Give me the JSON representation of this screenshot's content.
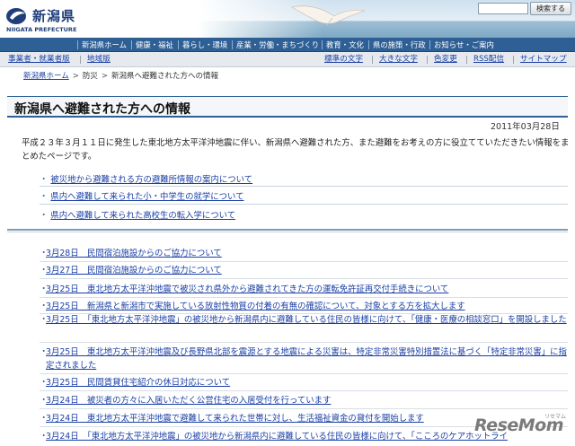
{
  "header": {
    "logo_text": "新潟県",
    "logo_sub": "NIIGATA PREFECTURE",
    "search_button": "検索する"
  },
  "nav": {
    "items": [
      "新潟県ホーム",
      "健康・福祉",
      "暮らし・環境",
      "産業・労働・まちづくり",
      "教育・文化",
      "県の施策・行政",
      "お知らせ・ご案内"
    ]
  },
  "util": {
    "left": [
      "事業者・就業者版",
      "地域版"
    ],
    "right": [
      "標準の文字",
      "大きな文字",
      "色変更",
      "RSS配信",
      "サイトマップ"
    ]
  },
  "breadcrumb": {
    "home": "新潟県ホーム",
    "section": "防災",
    "current": "新潟県へ避難された方への情報",
    "sep": ">"
  },
  "page": {
    "title": "新潟県へ避難された方への情報",
    "date": "2011年03月28日",
    "intro": "平成２３年３月１１日に発生した東北地方太平洋沖地震に伴い、新潟県へ避難された方、また避難をお考えの方に役立てていただきたい情報をまとめたページです。",
    "bullet": "・",
    "links": [
      "被災地から避難される方の避難所情報の案内について",
      "県内へ避難して来られた小・中学生の就学について",
      "県内へ避難して来られた高校生の転入学について"
    ],
    "news": [
      "3月28日　民間宿泊施設からのご協力について",
      "3月27日　民間宿泊施設からのご協力について",
      "3月25日　東北地方太平洋沖地震で被災され県外から避難されてきた方の運転免許証再交付手続きについて",
      "3月25日　新潟県と新潟市で実施している放射性物質の付着の有無の確認について、対象とする方を拡大します",
      "3月25日　「東北地方太平洋沖地震」の被災地から新潟県内に避難している住民の皆様に向けて、「健康・医療の相談窓口」を開設しました",
      "3月25日　東北地方太平洋沖地震及び長野県北部を震源とする地震による災害は、特定非常災害特別措置法に基づく「特定非常災害」に指定されました",
      "3月25日　民間賃貸住宅紹介の休日対応について",
      "3月24日　被災者の方々に入居いただく公営住宅の入居受付を行っています",
      "3月24日　東北地方太平洋沖地震で避難して来られた世帯に対し、生活福祉資金の貸付を開始します",
      "3月24日　「東北地方太平洋沖地震」の被災地から新潟県内に避難している住民の皆様に向けて、「こころのケアホットライ"
    ]
  },
  "watermark": {
    "main": "ReseMom",
    "sub": "リセマム"
  }
}
